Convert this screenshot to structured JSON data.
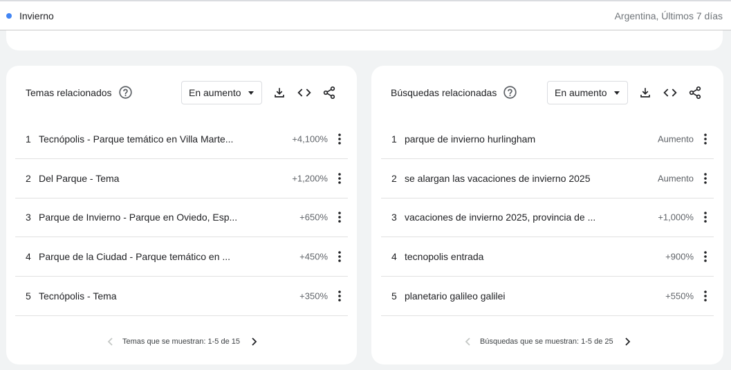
{
  "topbar": {
    "term": "Invierno",
    "term_color": "#4285f4",
    "filters": "Argentina, Últimos 7 días"
  },
  "topics": {
    "title": "Temas relacionados",
    "select_value": "En aumento",
    "rows": [
      {
        "rank": "1",
        "label": "Tecnópolis - Parque temático en Villa Marte...",
        "value": "+4,100%"
      },
      {
        "rank": "2",
        "label": "Del Parque - Tema",
        "value": "+1,200%"
      },
      {
        "rank": "3",
        "label": "Parque de Invierno - Parque en Oviedo, Esp...",
        "value": "+650%"
      },
      {
        "rank": "4",
        "label": "Parque de la Ciudad - Parque temático en ...",
        "value": "+450%"
      },
      {
        "rank": "5",
        "label": "Tecnópolis - Tema",
        "value": "+350%"
      }
    ],
    "pager": "Temas que se muestran: 1-5 de 15"
  },
  "queries": {
    "title": "Búsquedas relacionadas",
    "select_value": "En aumento",
    "rows": [
      {
        "rank": "1",
        "label": "parque de invierno hurlingham",
        "value": "Aumento"
      },
      {
        "rank": "2",
        "label": "se alargan las vacaciones de invierno 2025",
        "value": "Aumento"
      },
      {
        "rank": "3",
        "label": "vacaciones de invierno 2025, provincia de ...",
        "value": "+1,000%"
      },
      {
        "rank": "4",
        "label": "tecnopolis entrada",
        "value": "+900%"
      },
      {
        "rank": "5",
        "label": "planetario galileo galilei",
        "value": "+550%"
      }
    ],
    "pager": "Búsquedas que se muestran: 1-5 de 25"
  },
  "icons": {
    "help": "help-circle-icon",
    "download": "download-icon",
    "embed": "code-icon",
    "share": "share-icon",
    "more": "more-vert-icon",
    "prev": "chevron-left-icon",
    "next": "chevron-right-icon"
  }
}
